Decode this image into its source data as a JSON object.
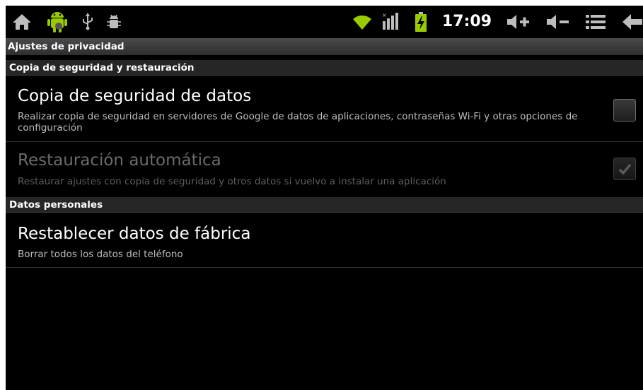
{
  "status_bar": {
    "time": "17:09",
    "icons": [
      "home-icon",
      "android-robot-icon",
      "usb-icon",
      "debug-bug-icon",
      "wifi-icon",
      "signal-icon",
      "battery-charging-icon",
      "volume-up-icon",
      "volume-down-icon",
      "menu-icon",
      "back-icon"
    ]
  },
  "screen": {
    "title": "Ajustes de privacidad"
  },
  "sections": [
    {
      "header": "Copia de seguridad y restauración",
      "items": [
        {
          "title": "Copia de seguridad de datos",
          "summary": "Realizar copia de seguridad en servidores de Google de datos de aplicaciones, contraseñas Wi-Fi y otras opciones de configuración",
          "checked": false,
          "enabled": true
        },
        {
          "title": "Restauración automática",
          "summary": "Restaurar ajustes con copia de seguridad y otros datos si vuelvo a instalar una aplicación",
          "checked": true,
          "enabled": false
        }
      ]
    },
    {
      "header": "Datos personales",
      "items": [
        {
          "title": "Restablecer datos de fábrica",
          "summary": "Borrar todos los datos del teléfono"
        }
      ]
    }
  ],
  "colors": {
    "accent_green": "#99cc00",
    "background": "#000000",
    "header_bg": "#262626"
  }
}
